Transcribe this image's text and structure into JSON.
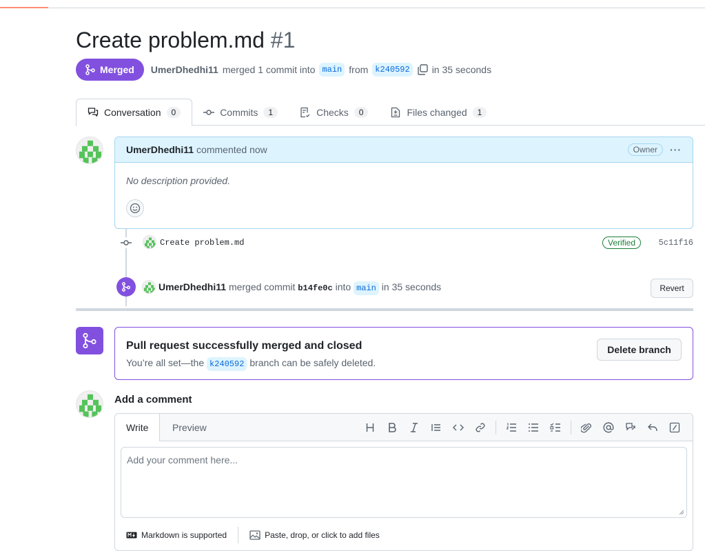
{
  "pr": {
    "title": "Create problem.md",
    "number": "#1",
    "state": "Merged",
    "author": "UmerDhedhi11",
    "merged_text": "merged 1 commit into",
    "base_branch": "main",
    "from_text": "from",
    "head_branch": "k240592",
    "time": "in 35 seconds"
  },
  "tabs": [
    {
      "label": "Conversation",
      "count": "0",
      "icon": "comment-discussion-icon"
    },
    {
      "label": "Commits",
      "count": "1",
      "icon": "git-commit-icon"
    },
    {
      "label": "Checks",
      "count": "0",
      "icon": "checklist-icon"
    },
    {
      "label": "Files changed",
      "count": "1",
      "icon": "file-diff-icon"
    }
  ],
  "comment": {
    "author": "UmerDhedhi11",
    "action": "commented now",
    "badge": "Owner",
    "body": "No description provided."
  },
  "commit": {
    "message": "Create problem.md",
    "verified": "Verified",
    "sha": "5c11f16"
  },
  "merge_event": {
    "author": "UmerDhedhi11",
    "text1": "merged commit",
    "sha": "b14fe0c",
    "text2": "into",
    "branch": "main",
    "time": "in 35 seconds",
    "revert_label": "Revert"
  },
  "merge_box": {
    "title": "Pull request successfully merged and closed",
    "sub1": "You’re all set—the",
    "branch": "k240592",
    "sub2": "branch can be safely deleted.",
    "delete_label": "Delete branch"
  },
  "editor": {
    "heading": "Add a comment",
    "write_tab": "Write",
    "preview_tab": "Preview",
    "placeholder": "Add your comment here...",
    "markdown_note": "Markdown is supported",
    "files_note": "Paste, drop, or click to add files"
  },
  "colors": {
    "merged_purple": "#8250df",
    "link_blue": "#0969da",
    "verified_green": "#1a7f37",
    "comment_header_bg": "#ddf4ff"
  }
}
